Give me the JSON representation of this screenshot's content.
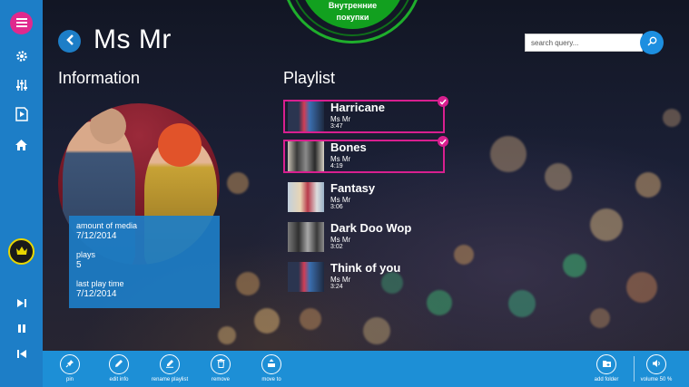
{
  "header": {
    "title": "Ms Mr",
    "purchase_label_line1": "Внутренние",
    "purchase_label_line2": "покупки"
  },
  "search": {
    "placeholder": "search query..."
  },
  "info": {
    "heading": "Information",
    "amount_label": "amount of media",
    "amount_value": "7/12/2014",
    "plays_label": "plays",
    "plays_value": "5",
    "last_play_label": "last play time",
    "last_play_value": "7/12/2014"
  },
  "playlist": {
    "heading": "Playlist",
    "tracks": [
      {
        "title": "Harricane",
        "artist": "Ms Mr",
        "duration": "3:47",
        "selected": true
      },
      {
        "title": "Bones",
        "artist": "Ms Mr",
        "duration": "4:19",
        "selected": true
      },
      {
        "title": "Fantasy",
        "artist": "Ms Mr",
        "duration": "3:06",
        "selected": false
      },
      {
        "title": "Dark Doo Wop",
        "artist": "Ms Mr",
        "duration": "3:02",
        "selected": false
      },
      {
        "title": "Think of you",
        "artist": "Ms Mr",
        "duration": "3:24",
        "selected": false
      }
    ]
  },
  "appbar": {
    "pin": "pin",
    "edit_info": "edit info",
    "rename_playlist": "rename playlist",
    "remove": "remove",
    "move_to": "move to",
    "add_folder": "add folder",
    "volume": "volume 50 %"
  },
  "sidebar": {
    "icons": [
      "menu-icon",
      "gear-icon",
      "equalizer-icon",
      "video-icon",
      "home-icon",
      "crown-icon",
      "next-track-icon",
      "pause-icon",
      "previous-track-icon"
    ]
  },
  "colors": {
    "accent_blue": "#1d7ec7",
    "selection_pink": "#d81f8f",
    "purchase_green": "#12a01f"
  }
}
